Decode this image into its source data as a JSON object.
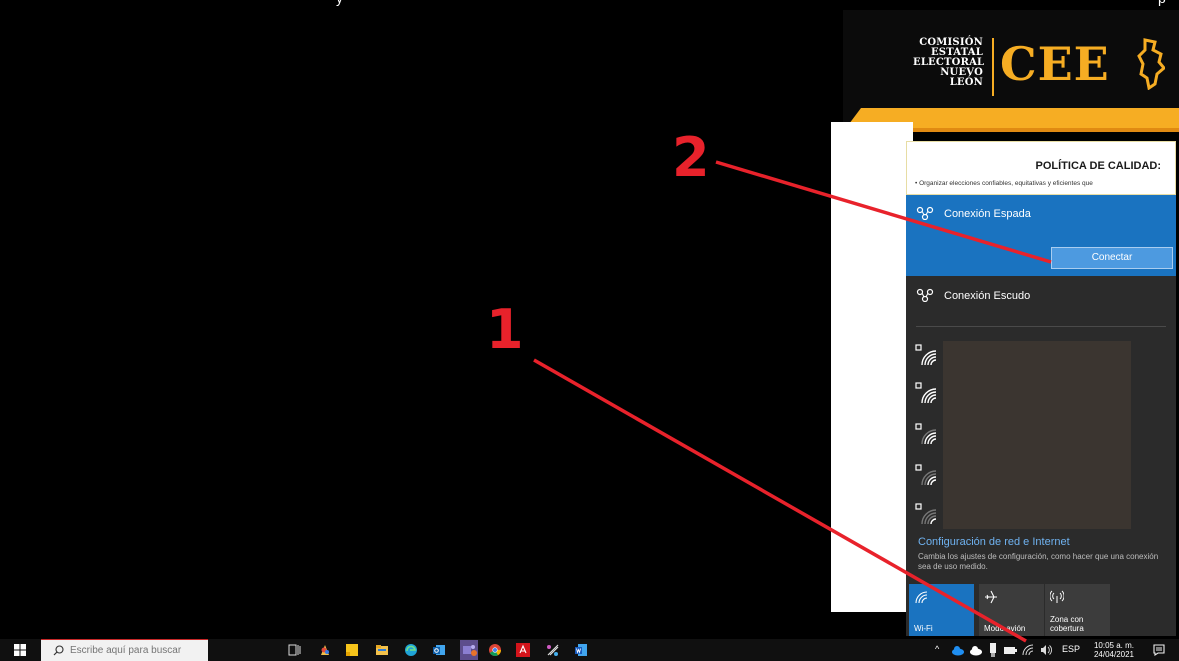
{
  "top_fragments": [
    {
      "text": "y"
    },
    {
      "text": "p"
    }
  ],
  "logo": {
    "lines": [
      "COMISIÓN",
      "ESTATAL",
      "ELECTORAL",
      "NUEVO LEÓN"
    ],
    "abbr": "CEE"
  },
  "quality_notice": {
    "title": "POLÍTICA DE CALIDAD:",
    "bullet": "•  Organizar  elecciones  confiables,  equitativas  y  eficientes  que"
  },
  "network_flyout": {
    "vpn_connections": [
      {
        "name": "Conexión Espada",
        "selected": true,
        "action": "Conectar"
      },
      {
        "name": "Conexión Escudo",
        "selected": false
      }
    ],
    "wifi_networks_count": 5,
    "settings_link": "Configuración de red e Internet",
    "settings_desc": "Cambia los ajustes de configuración, como hacer que una conexión sea de uso medido.",
    "tiles": [
      {
        "label": "Wi-Fi",
        "active": true,
        "icon": "wifi-icon"
      },
      {
        "label": "Modo avión",
        "active": false,
        "icon": "airplane-icon"
      },
      {
        "label": "Zona con\ncobertura",
        "active": false,
        "icon": "hotspot-icon"
      }
    ]
  },
  "taskbar": {
    "search_placeholder": "Escribe aquí para buscar",
    "language": "ESP",
    "time": "10:05 a. m.",
    "date": "24/04/2021",
    "pinned_apps": [
      "task-view-icon",
      "paint-icon",
      "sticky-notes-icon",
      "file-explorer-icon",
      "edge-icon",
      "outlook-icon",
      "teams-icon",
      "chrome-icon",
      "acrobat-icon",
      "snip-icon",
      "word-icon"
    ]
  },
  "annotations": {
    "step1": "1",
    "step2": "2",
    "color": "#e8222b"
  },
  "colors": {
    "accent_blue": "#1a73c0",
    "flyout_bg": "#2b2b2b",
    "brand_orange": "#f6ad23"
  }
}
